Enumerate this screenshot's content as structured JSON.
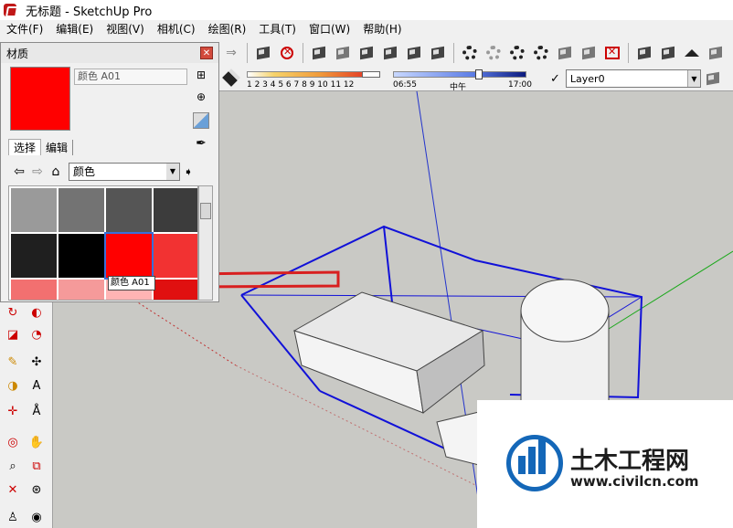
{
  "window": {
    "title": "无标题 - SketchUp Pro"
  },
  "menu": [
    "文件(F)",
    "编辑(E)",
    "视图(V)",
    "相机(C)",
    "绘图(R)",
    "工具(T)",
    "窗口(W)",
    "帮助(H)"
  ],
  "shadow": {
    "month_labels": "1 2 3 4 5 6 7 8 9 10 11 12",
    "time_start": "06:55",
    "time_mid": "中午",
    "time_end": "17:00"
  },
  "layer": {
    "current": "Layer0"
  },
  "materials": {
    "title": "材质",
    "current_name": "颜色 A01",
    "tabs": [
      "选择",
      "编辑"
    ],
    "collection": "颜色",
    "swatches": [
      "#9a9a9a",
      "#737373",
      "#555555",
      "#3c3c3c",
      "#1f1f1f",
      "#000000",
      "#ff0000",
      "#f23232",
      "#f27070",
      "#f59a9a",
      "#ffb4b4",
      "#e01010"
    ],
    "tooltip": "颜色 A01",
    "selected_color": "#ff0000"
  },
  "watermark": {
    "title": "土木工程网",
    "url": "www.civilcn.com"
  }
}
